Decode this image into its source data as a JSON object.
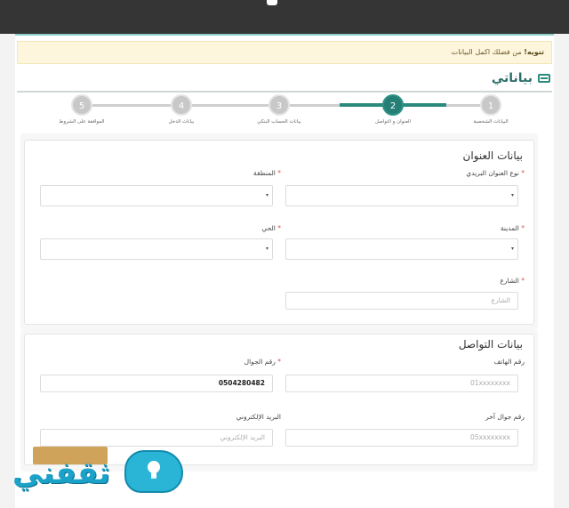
{
  "alert": {
    "strong": "تنويه!",
    "text": " من فضلك اكمل البيانات"
  },
  "page_title": "بياناتي",
  "stepper": {
    "steps": [
      {
        "num": "1",
        "label": "البيانات الشخصية",
        "active": false
      },
      {
        "num": "2",
        "label": "العنوان و التواصل",
        "active": true
      },
      {
        "num": "3",
        "label": "بيانات الحساب البنكي",
        "active": false
      },
      {
        "num": "4",
        "label": "بيانات الدخل",
        "active": false
      },
      {
        "num": "5",
        "label": "الموافقة على الشروط",
        "active": false
      }
    ]
  },
  "address": {
    "title": "بيانات العنوان",
    "postal_type_label": "نوع العنوان البريدي",
    "postal_type_value": "",
    "region_label": "المنطقة",
    "region_value": "",
    "city_label": "المدينة",
    "city_value": "",
    "district_label": "الحي",
    "district_value": "",
    "street_label": "الشارع",
    "street_placeholder": "الشارع"
  },
  "contact": {
    "title": "بيانات التواصل",
    "phone_label": "رقم الهاتف",
    "phone_placeholder": "01xxxxxxxx",
    "mobile_label": "رقم الجوال",
    "mobile_value": "0504280482",
    "other_mobile_label": "رقم جوال آخر",
    "other_mobile_placeholder": "05xxxxxxxx",
    "email_label": "البريد الإلكتروني",
    "email_placeholder": "البريد الإلكتروني"
  },
  "required_mark": "*",
  "watermark": "ثقفني",
  "colors": {
    "primary": "#2a8a7e",
    "alert_bg": "#fdf5dc",
    "required": "#d9534f",
    "logo": "#1aa2c9"
  }
}
